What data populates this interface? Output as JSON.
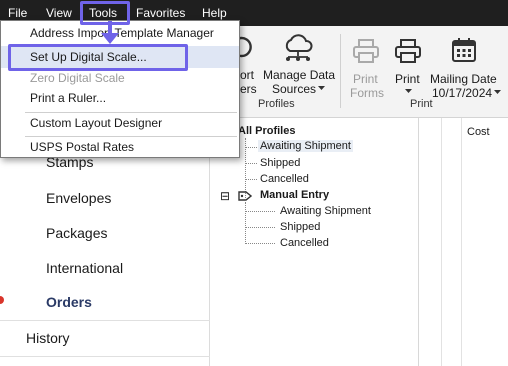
{
  "menubar": {
    "items": [
      {
        "label": "File"
      },
      {
        "label": "View"
      },
      {
        "label": "Tools"
      },
      {
        "label": "Favorites"
      },
      {
        "label": "Help"
      }
    ]
  },
  "tools_menu": {
    "items": [
      {
        "label": "Address Import Template Manager"
      },
      {
        "label": "Set Up Digital Scale..."
      },
      {
        "label": "Zero Digital Scale"
      },
      {
        "label": "Print a Ruler..."
      },
      {
        "label": "Custom Layout Designer"
      },
      {
        "label": "USPS Postal Rates"
      }
    ]
  },
  "toolbar": {
    "partial_labels": [
      "ort",
      "ers"
    ],
    "manage_data": {
      "line1": "Manage Data",
      "line2": "Sources"
    },
    "profiles_group": "Profiles",
    "print_forms": {
      "line1": "Print",
      "line2": "Forms"
    },
    "print": {
      "line1": "Print"
    },
    "mailing_date": {
      "line1": "Mailing Date",
      "line2": "10/17/2024"
    },
    "print_group": "Print"
  },
  "left_nav": {
    "items": [
      {
        "label": "Stamps"
      },
      {
        "label": "Envelopes"
      },
      {
        "label": "Packages"
      },
      {
        "label": "International"
      },
      {
        "label": "Orders"
      },
      {
        "label": "History"
      }
    ]
  },
  "tree": {
    "all_profiles": "All Profiles",
    "all_children": [
      "Awaiting Shipment",
      "Shipped",
      "Cancelled"
    ],
    "manual_entry": "Manual Entry",
    "manual_children": [
      "Awaiting Shipment",
      "Shipped",
      "Cancelled"
    ],
    "expander": "⊟"
  },
  "grid": {
    "columns": [
      "Cost"
    ]
  },
  "colors": {
    "highlight_frame": "#6f63e8",
    "menubar_bg": "#1f1f1f",
    "orders_active": "#2a3a66",
    "active_marker": "#d9352b"
  }
}
